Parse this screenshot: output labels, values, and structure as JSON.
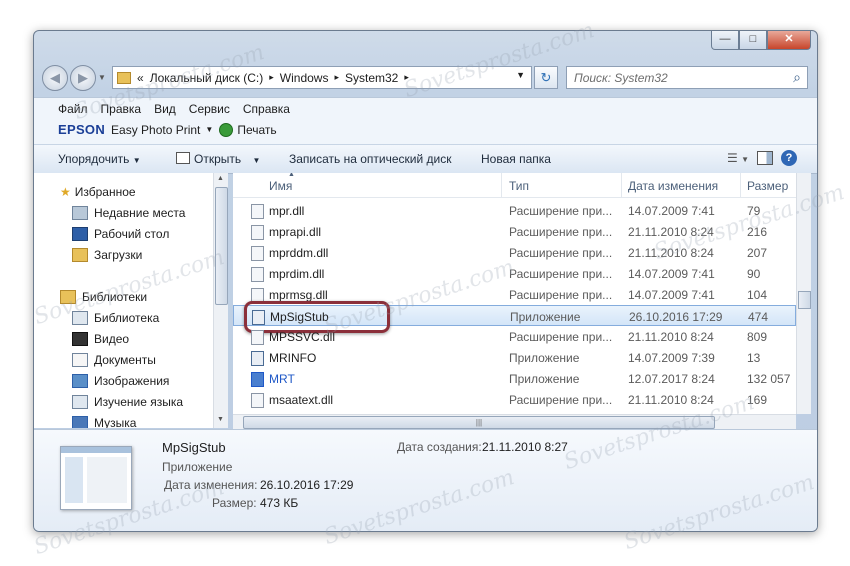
{
  "window": {
    "controls": {
      "minimize": "—",
      "maximize": "□",
      "close": "✕"
    },
    "nav": {
      "back_icon": "back-arrow",
      "forward_icon": "forward-arrow"
    },
    "address": {
      "prefix": "«",
      "crumbs": [
        "Локальный диск (C:)",
        "Windows",
        "System32"
      ],
      "sep": "▸"
    },
    "search": {
      "placeholder": "Поиск: System32"
    },
    "menu": [
      "Файл",
      "Правка",
      "Вид",
      "Сервис",
      "Справка"
    ],
    "epson": {
      "brand": "EPSON",
      "app": "Easy Photo Print",
      "print": "Печать"
    },
    "toolbar": {
      "organize": "Упорядочить",
      "open": "Открыть",
      "burn": "Записать на оптический диск",
      "new_folder": "Новая папка",
      "help": "?"
    },
    "sidebar": {
      "favorites": "Избранное",
      "favorites_items": [
        "Недавние места",
        "Рабочий стол",
        "Загрузки"
      ],
      "libraries": "Библиотеки",
      "libraries_items": [
        "Библиотека",
        "Видео",
        "Документы",
        "Изображения",
        "Изучение языка",
        "Музыка"
      ]
    },
    "columns": [
      "Имя",
      "Тип",
      "Дата изменения",
      "Размер"
    ],
    "files": [
      {
        "name": "mpr.dll",
        "type": "Расширение при...",
        "date": "14.07.2009 7:41",
        "size": "79"
      },
      {
        "name": "mprapi.dll",
        "type": "Расширение при...",
        "date": "21.11.2010 8:24",
        "size": "216"
      },
      {
        "name": "mprddm.dll",
        "type": "Расширение при...",
        "date": "21.11.2010 8:24",
        "size": "207"
      },
      {
        "name": "mprdim.dll",
        "type": "Расширение при...",
        "date": "14.07.2009 7:41",
        "size": "90"
      },
      {
        "name": "mprmsg.dll",
        "type": "Расширение при...",
        "date": "14.07.2009 7:41",
        "size": "104"
      },
      {
        "name": "MpSigStub",
        "type": "Приложение",
        "date": "26.10.2016 17:29",
        "size": "474"
      },
      {
        "name": "MPSSVC.dll",
        "type": "Расширение при...",
        "date": "21.11.2010 8:24",
        "size": "809"
      },
      {
        "name": "MRINFO",
        "type": "Приложение",
        "date": "14.07.2009 7:39",
        "size": "13"
      },
      {
        "name": "MRT",
        "type": "Приложение",
        "date": "12.07.2017 8:24",
        "size": "132 057"
      },
      {
        "name": "msaatext.dll",
        "type": "Расширение при...",
        "date": "21.11.2010 8:24",
        "size": "169"
      }
    ],
    "details": {
      "name": "MpSigStub",
      "type": "Приложение",
      "modified_label": "Дата изменения:",
      "modified": "26.10.2016 17:29",
      "size_label": "Размер:",
      "size": "473 КБ",
      "created_label": "Дата создания:",
      "created": "21.11.2010 8:27"
    }
  },
  "watermark": "Sovetsprosta.com",
  "colors": {
    "selection": "#d3e5f8",
    "highlight_ring": "#8b2f3a",
    "epson": "#1b3f97",
    "link": "#1f58c7"
  }
}
